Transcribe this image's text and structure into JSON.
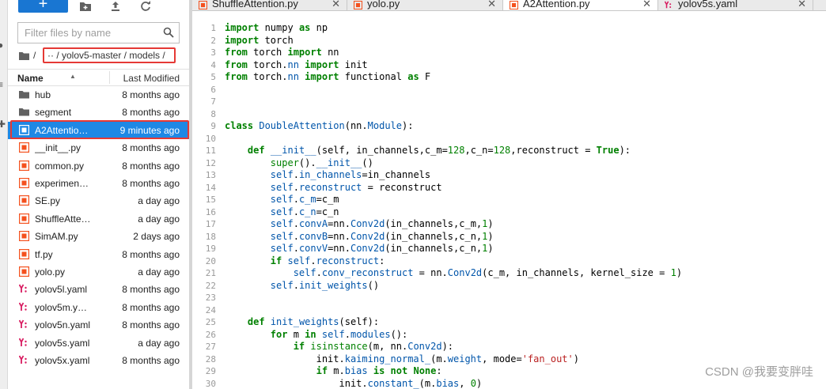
{
  "toolbar": {
    "new_label": "+"
  },
  "filter": {
    "placeholder": "Filter files by name"
  },
  "breadcrumb": {
    "root": "/",
    "path": "·· / yolov5-master / models /"
  },
  "file_list": {
    "name_header": "Name",
    "modified_header": "Last Modified",
    "items": [
      {
        "name": "hub",
        "modified": "8 months ago",
        "icon": "folder-icon"
      },
      {
        "name": "segment",
        "modified": "8 months ago",
        "icon": "folder-icon"
      },
      {
        "name": "A2Attentio…",
        "modified": "9 minutes ago",
        "icon": "python-file-icon"
      },
      {
        "name": "__init__.py",
        "modified": "8 months ago",
        "icon": "python-file-icon"
      },
      {
        "name": "common.py",
        "modified": "8 months ago",
        "icon": "python-file-icon"
      },
      {
        "name": "experimen…",
        "modified": "8 months ago",
        "icon": "python-file-icon"
      },
      {
        "name": "SE.py",
        "modified": "a day ago",
        "icon": "python-file-icon"
      },
      {
        "name": "ShuffleAtte…",
        "modified": "a day ago",
        "icon": "python-file-icon"
      },
      {
        "name": "SimAM.py",
        "modified": "2 days ago",
        "icon": "python-file-icon"
      },
      {
        "name": "tf.py",
        "modified": "8 months ago",
        "icon": "python-file-icon"
      },
      {
        "name": "yolo.py",
        "modified": "a day ago",
        "icon": "python-file-icon"
      },
      {
        "name": "yolov5l.yaml",
        "modified": "8 months ago",
        "icon": "yaml-file-icon"
      },
      {
        "name": "yolov5m.y…",
        "modified": "8 months ago",
        "icon": "yaml-file-icon"
      },
      {
        "name": "yolov5n.yaml",
        "modified": "8 months ago",
        "icon": "yaml-file-icon"
      },
      {
        "name": "yolov5s.yaml",
        "modified": "a day ago",
        "icon": "yaml-file-icon"
      },
      {
        "name": "yolov5x.yaml",
        "modified": "8 months ago",
        "icon": "yaml-file-icon"
      }
    ]
  },
  "tabs": [
    {
      "label": "ShuffleAttention.py",
      "close": "✕",
      "icon": "python-file-icon"
    },
    {
      "label": "yolo.py",
      "close": "✕",
      "icon": "python-file-icon"
    },
    {
      "label": "A2Attention.py",
      "close": "✕",
      "icon": "python-file-icon"
    },
    {
      "label": "yolov5s.yaml",
      "close": "✕",
      "icon": "yaml-file-icon"
    }
  ],
  "editor": {
    "line_numbers": [
      "1",
      "2",
      "3",
      "4",
      "5",
      "6",
      "7",
      "8",
      "9",
      "10",
      "11",
      "12",
      "13",
      "14",
      "15",
      "16",
      "17",
      "18",
      "19",
      "20",
      "21",
      "22",
      "23",
      "24",
      "25",
      "26",
      "27",
      "28",
      "29",
      "30"
    ]
  },
  "watermark": "CSDN @我要变胖哇",
  "colors": {
    "accent": "#1e88e5",
    "highlight_border": "#e53935",
    "python_icon": "#f4511e",
    "yaml_icon": "#d81b60"
  }
}
